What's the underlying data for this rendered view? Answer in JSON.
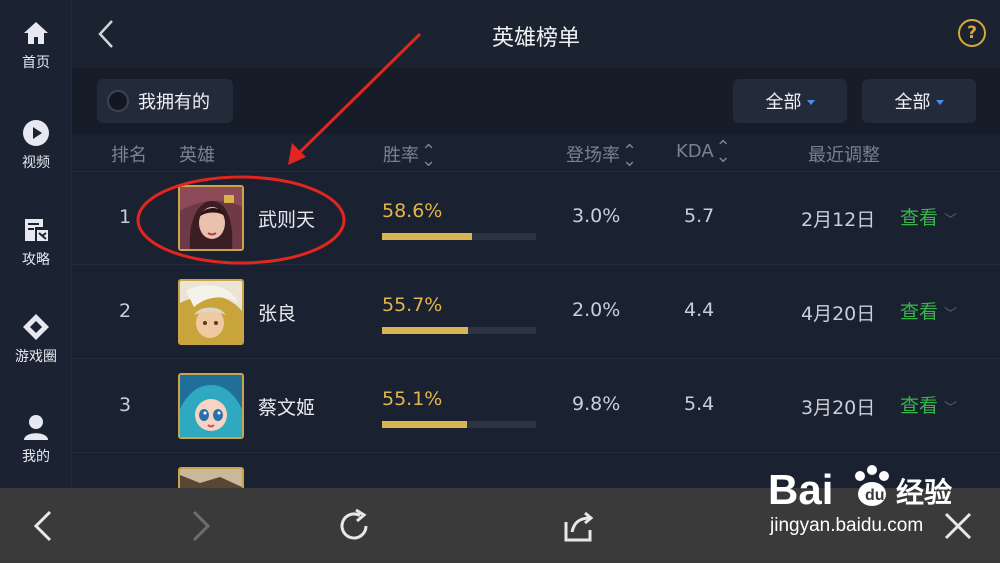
{
  "sidebar": {
    "items": [
      {
        "label": "首页",
        "icon": "home-icon"
      },
      {
        "label": "视频",
        "icon": "play-icon"
      },
      {
        "label": "攻略",
        "icon": "guide-icon"
      },
      {
        "label": "游戏圈",
        "icon": "community-icon"
      },
      {
        "label": "我的",
        "icon": "user-icon"
      }
    ]
  },
  "header": {
    "title": "英雄榜单",
    "help": "?"
  },
  "filters": {
    "owned_label": "我拥有的",
    "dropdown1": "全部",
    "dropdown2": "全部",
    "caret_color": "#4a8ff0"
  },
  "columns": {
    "rank": "排名",
    "hero": "英雄",
    "win_rate": "胜率",
    "pick_rate": "登场率",
    "kda": "KDA",
    "adjust": "最近调整"
  },
  "rows": [
    {
      "rank": "1",
      "name": "武则天",
      "win": "58.6%",
      "win_fraction": 0.586,
      "pick": "3.0%",
      "kda": "5.7",
      "adjust": "2月12日",
      "action": "查看"
    },
    {
      "rank": "2",
      "name": "张良",
      "win": "55.7%",
      "win_fraction": 0.557,
      "pick": "2.0%",
      "kda": "4.4",
      "adjust": "4月20日",
      "action": "查看"
    },
    {
      "rank": "3",
      "name": "蔡文姬",
      "win": "55.1%",
      "win_fraction": 0.551,
      "pick": "9.8%",
      "kda": "5.4",
      "adjust": "3月20日",
      "action": "查看"
    }
  ],
  "colors": {
    "win_rate": "#e3b64a",
    "view_link": "#37b548",
    "annotation": "#e0261f",
    "help": "#d8a93a"
  },
  "watermark": {
    "brand": "Bai",
    "brand_suffix": "经验",
    "site": "jingyan.baidu.com"
  }
}
